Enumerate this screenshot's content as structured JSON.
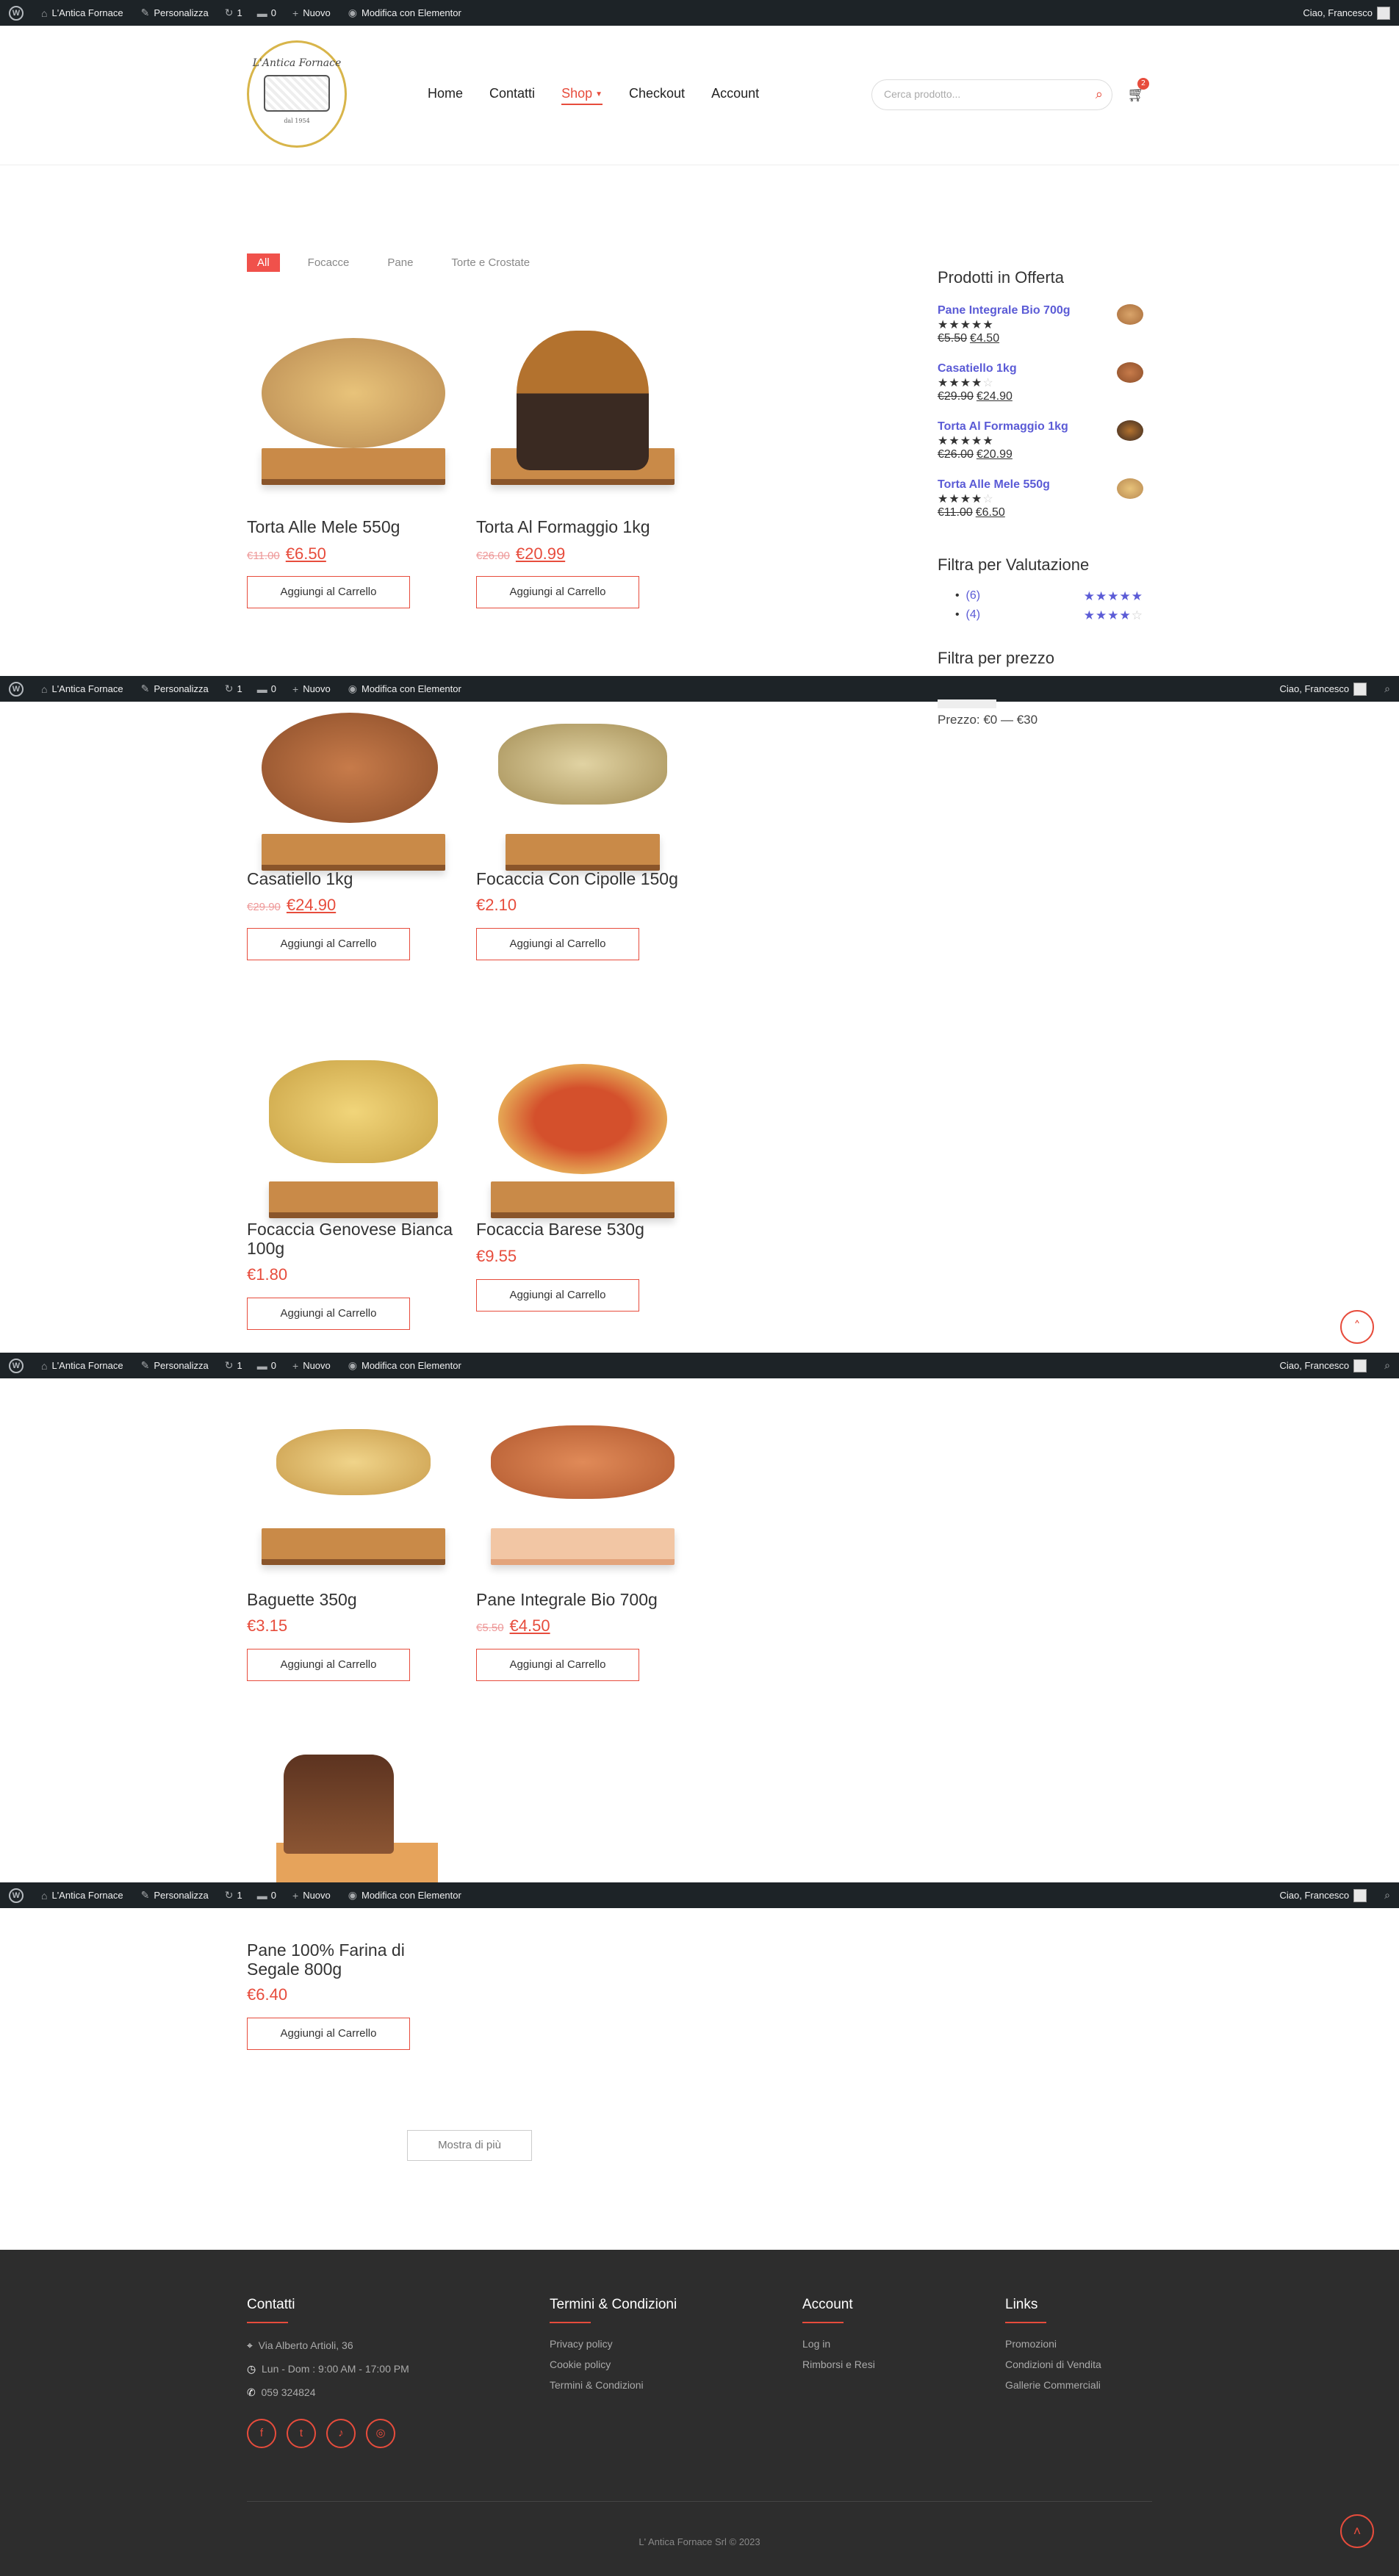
{
  "admin_bar": {
    "site_name": "L'Antica Fornace",
    "customize": "Personalizza",
    "updates": "1",
    "comments": "0",
    "new": "Nuovo",
    "elementor": "Modifica con Elementor",
    "greeting": "Ciao, Francesco"
  },
  "header": {
    "logo_text": "L'Antica Fornace",
    "logo_sub": "dal 1954",
    "nav": [
      "Home",
      "Contatti",
      "Shop",
      "Checkout",
      "Account"
    ],
    "search_placeholder": "Cerca prodotto...",
    "cart_count": "2"
  },
  "filters": [
    "All",
    "Focacce",
    "Pane",
    "Torte e Crostate"
  ],
  "cart_label": "Aggiungi al Carrello",
  "products": [
    {
      "name": "Torta Alle Mele 550g",
      "old": "€11.00",
      "price": "€6.50"
    },
    {
      "name": "Torta Al Formaggio 1kg",
      "old": "€26.00",
      "price": "€20.99"
    },
    {
      "name": "Casatiello 1kg",
      "old": "€29.90",
      "price": "€24.90"
    },
    {
      "name": "Focaccia Con Cipolle 150g",
      "old": "",
      "price": "€2.10"
    },
    {
      "name": "Focaccia Genovese Bianca 100g",
      "old": "",
      "price": "€1.80"
    },
    {
      "name": "Focaccia Barese 530g",
      "old": "",
      "price": "€9.55"
    },
    {
      "name": "Baguette 350g",
      "old": "",
      "price": "€3.15"
    },
    {
      "name": "Pane Integrale Bio 700g",
      "old": "€5.50",
      "price": "€4.50"
    },
    {
      "name": "Pane 100% Farina di Segale 800g",
      "old": "",
      "price": "€6.40"
    }
  ],
  "sidebar": {
    "offers_title": "Prodotti in Offerta",
    "offers": [
      {
        "name": "Pane Integrale Bio 700g",
        "rating": 4.5,
        "old": "€5.50",
        "price": "€4.50"
      },
      {
        "name": "Casatiello 1kg",
        "rating": 3.5,
        "old": "€29.90",
        "price": "€24.90"
      },
      {
        "name": "Torta Al Formaggio 1kg",
        "rating": 5,
        "old": "€26.00",
        "price": "€20.99"
      },
      {
        "name": "Torta Alle Mele 550g",
        "rating": 4,
        "old": "€11.00",
        "price": "€6.50"
      }
    ],
    "rating_title": "Filtra per Valutazione",
    "ratings": [
      {
        "count": "(6)",
        "stars": 5
      },
      {
        "count": "(4)",
        "stars": 4
      }
    ],
    "price_title": "Filtra per prezzo",
    "price_label": "Prezzo: €0 — €30"
  },
  "load_more": "Mostra di più",
  "footer": {
    "contacts_title": "Contatti",
    "address": "Via Alberto Artioli, 36",
    "hours": "Lun - Dom : 9:00 AM - 17:00 PM",
    "phone": "059 324824",
    "terms_title": "Termini & Condizioni",
    "terms_links": [
      "Privacy policy",
      "Cookie policy",
      "Termini & Condizioni"
    ],
    "account_title": "Account",
    "account_links": [
      "Log in",
      "Rimborsi e Resi"
    ],
    "links_title": "Links",
    "links": [
      "Promozioni",
      "Condizioni di Vendita",
      "Gallerie Commerciali"
    ],
    "copyright": "L' Antica Fornace Srl © 2023"
  },
  "colors": {
    "accent": "#e74c3c",
    "link": "#5b5bd6",
    "footer_bg": "#2d2d2d",
    "adminbar": "#1d2327"
  }
}
